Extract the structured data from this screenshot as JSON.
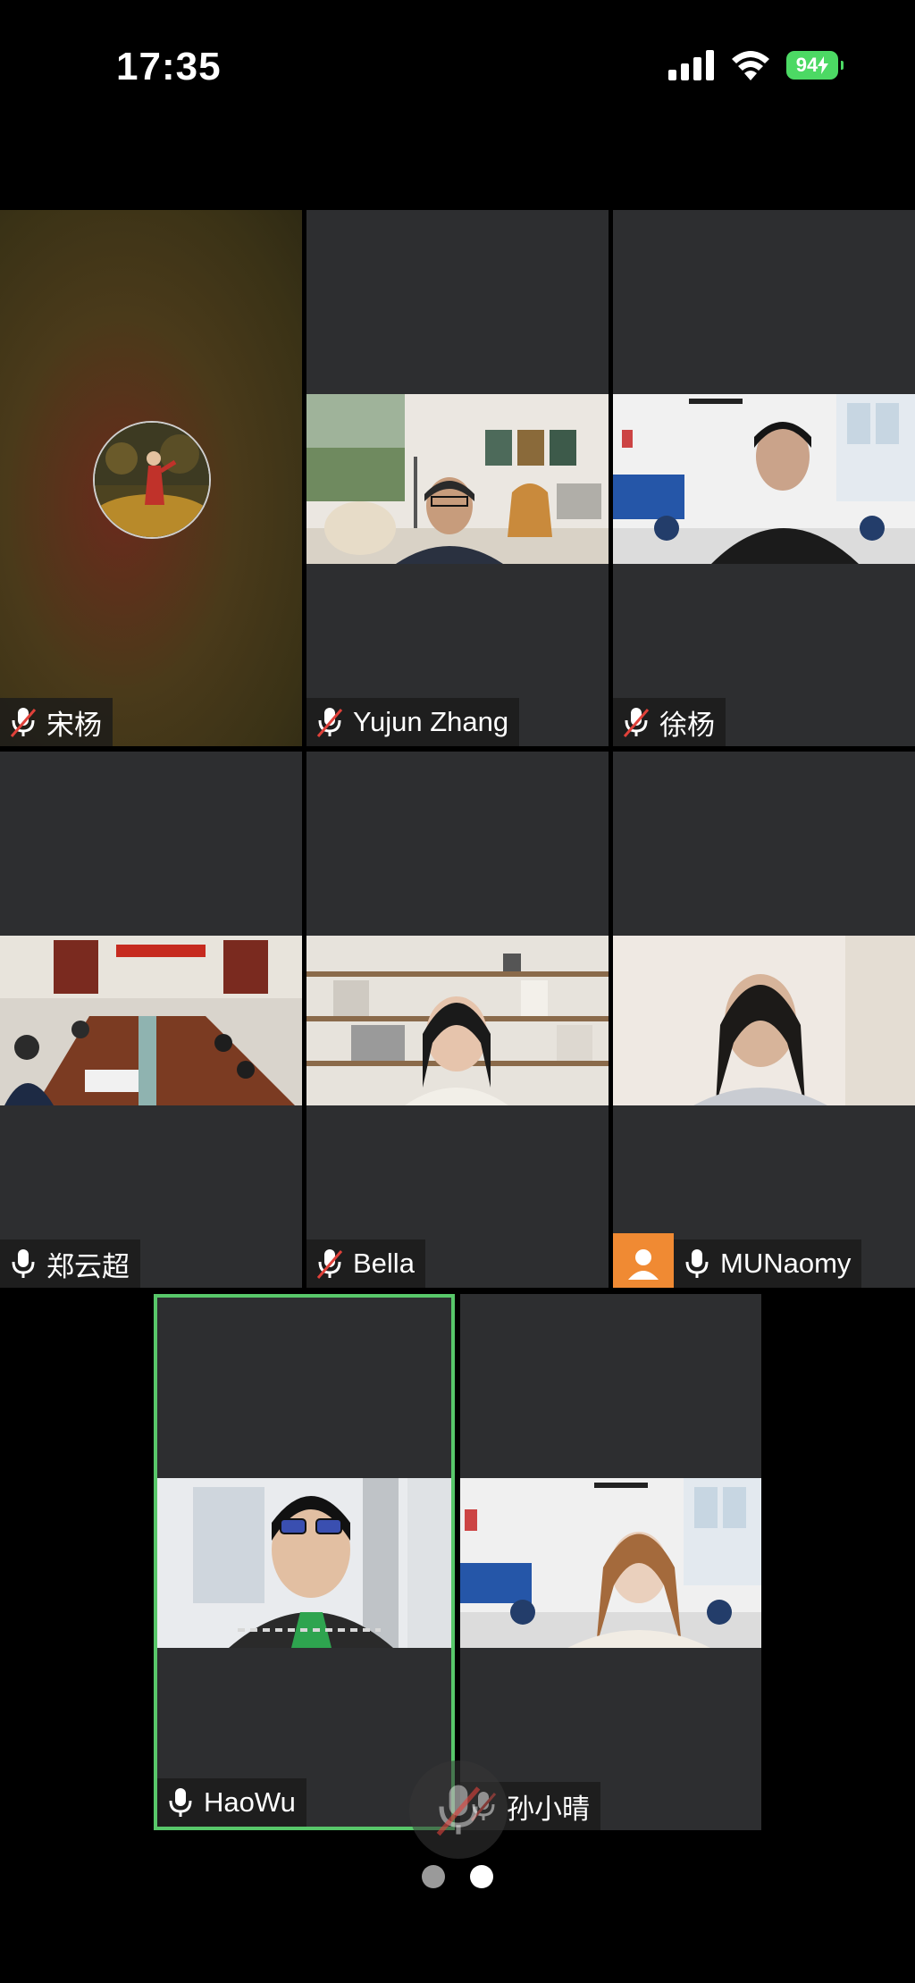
{
  "status_bar": {
    "time": "17:35",
    "battery": "94"
  },
  "participants": [
    {
      "name": "宋杨",
      "mic": "muted"
    },
    {
      "name": "Yujun Zhang",
      "mic": "muted"
    },
    {
      "name": "徐杨",
      "mic": "muted"
    },
    {
      "name": "郑云超",
      "mic": "on"
    },
    {
      "name": "Bella",
      "mic": "muted"
    },
    {
      "name": "MUNaomy",
      "mic": "on"
    },
    {
      "name": "HaoWu",
      "mic": "on",
      "active_speaker": true
    },
    {
      "name": "孙小晴",
      "mic": "muted"
    }
  ],
  "pager": {
    "pages": 2,
    "current": 2
  },
  "colors": {
    "tile_bg": "#2d2e30",
    "active_border": "#58c76a",
    "battery": "#4cd964",
    "avatar_placeholder": "#f08a33",
    "muted_slash": "#e0413a"
  }
}
